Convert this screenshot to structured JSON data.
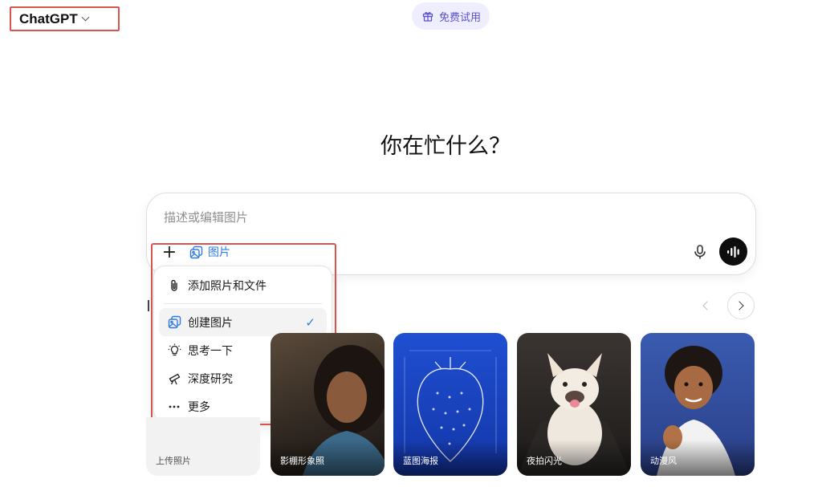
{
  "header": {
    "model_name": "ChatGPT",
    "trial_label": "免费试用"
  },
  "main": {
    "heading": "你在忙什么？"
  },
  "composer": {
    "placeholder": "描述或编辑图片",
    "active_tool_label": "图片"
  },
  "menu": {
    "items": [
      {
        "label": "添加照片和文件",
        "icon": "paperclip-icon"
      },
      {
        "label": "创建图片",
        "icon": "image-icon",
        "selected": true
      },
      {
        "label": "思考一下",
        "icon": "lightbulb-icon"
      },
      {
        "label": "深度研究",
        "icon": "telescope-icon"
      },
      {
        "label": "更多",
        "icon": "more-dots-icon",
        "has_submenu": true
      }
    ]
  },
  "cards": [
    {
      "caption": "上传照片"
    },
    {
      "caption": "影棚形象照"
    },
    {
      "caption": "蓝图海报"
    },
    {
      "caption": "夜拍闪光"
    },
    {
      "caption": "动漫风"
    }
  ],
  "colors": {
    "accent": "#2f7be5",
    "highlight_border": "#d9534f",
    "trial_text": "#5a4fcf",
    "trial_bg": "#efeefe"
  }
}
